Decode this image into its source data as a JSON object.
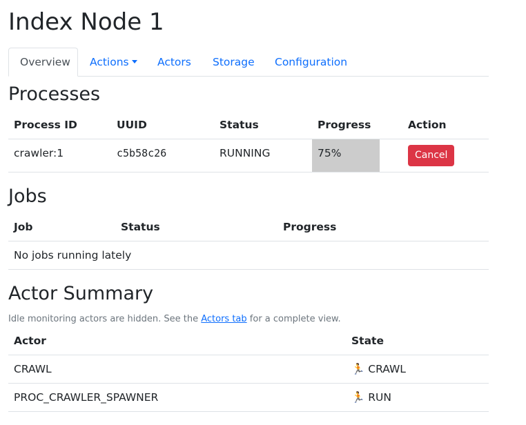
{
  "page": {
    "title": "Index Node 1"
  },
  "tabs": [
    {
      "label": "Overview",
      "active": true
    },
    {
      "label": "Actions",
      "dropdown": true
    },
    {
      "label": "Actors"
    },
    {
      "label": "Storage"
    },
    {
      "label": "Configuration"
    }
  ],
  "processes": {
    "heading": "Processes",
    "columns": [
      "Process ID",
      "UUID",
      "Status",
      "Progress",
      "Action"
    ],
    "rows": [
      {
        "process_id": "crawler:1",
        "uuid": "c5b58c26",
        "status": "RUNNING",
        "progress_label": "75%",
        "progress_fraction": 0.75,
        "action": "Cancel"
      }
    ]
  },
  "jobs": {
    "heading": "Jobs",
    "columns": [
      "Job",
      "Status",
      "Progress"
    ],
    "empty": "No jobs running lately"
  },
  "actors": {
    "heading": "Actor Summary",
    "note_prefix": "Idle monitoring actors are hidden. See the",
    "note_link": "Actors tab",
    "note_suffix": "for a complete view.",
    "columns": [
      "Actor",
      "State"
    ],
    "rows": [
      {
        "actor": "CRAWL",
        "state_icon": "🏃",
        "state": "CRAWL"
      },
      {
        "actor": "PROC_CRAWLER_SPAWNER",
        "state_icon": "🏃",
        "state": "RUN"
      }
    ]
  },
  "colors": {
    "link": "#0d6efd",
    "danger": "#dc3545",
    "progress": "#cccccc"
  }
}
